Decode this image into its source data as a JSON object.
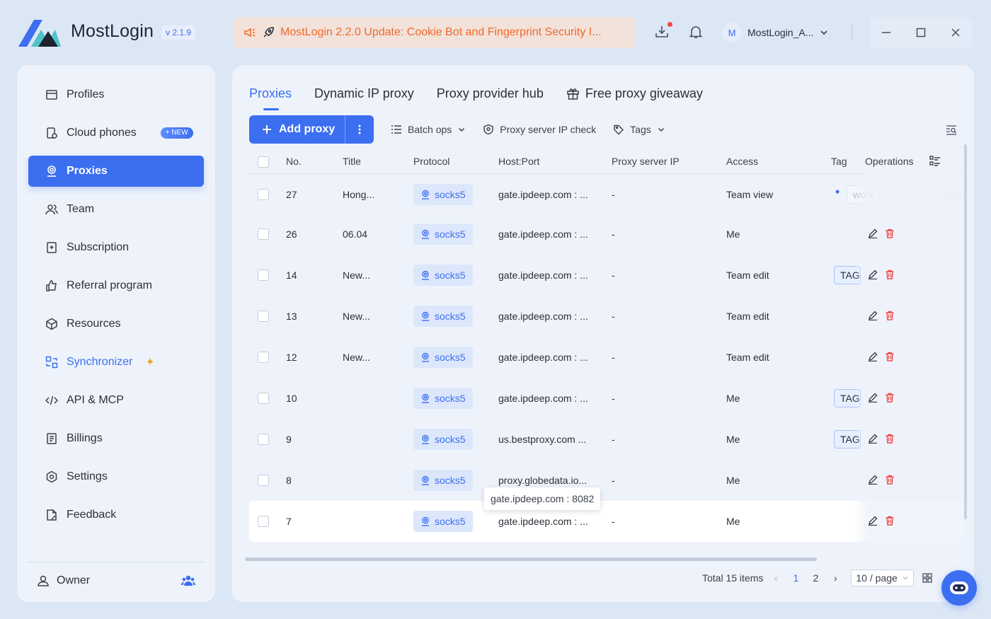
{
  "app": {
    "name": "MostLogin",
    "version": "v 2.1.9",
    "brand_color": "#3b6ff0"
  },
  "announcement": {
    "text": "MostLogin 2.2.0 Update: Cookie Bot and Fingerprint Security I..."
  },
  "user": {
    "avatar_letter": "M",
    "name": "MostLogin_A..."
  },
  "sidebar": {
    "items": [
      {
        "label": "Profiles",
        "icon": "profiles-icon"
      },
      {
        "label": "Cloud phones",
        "icon": "phone-icon",
        "badge": "+ NEW"
      },
      {
        "label": "Proxies",
        "icon": "proxy-icon",
        "active": true
      },
      {
        "label": "Team",
        "icon": "team-icon"
      },
      {
        "label": "Subscription",
        "icon": "subscription-icon"
      },
      {
        "label": "Referral program",
        "icon": "thumbs-up-icon"
      },
      {
        "label": "Resources",
        "icon": "cube-icon"
      },
      {
        "label": "Synchronizer",
        "icon": "synchronizer-icon"
      },
      {
        "label": "API & MCP",
        "icon": "code-icon"
      },
      {
        "label": "Billings",
        "icon": "billing-icon"
      },
      {
        "label": "Settings",
        "icon": "settings-icon"
      },
      {
        "label": "Feedback",
        "icon": "feedback-icon"
      }
    ],
    "owner_label": "Owner"
  },
  "tabs": [
    "Proxies",
    "Dynamic IP proxy",
    "Proxy provider hub",
    "Free proxy giveaway"
  ],
  "toolbar": {
    "add_proxy": "Add proxy",
    "batch_ops": "Batch ops",
    "ip_check": "Proxy server IP check",
    "tags": "Tags"
  },
  "table": {
    "columns": [
      "No.",
      "Title",
      "Protocol",
      "Host:Port",
      "Proxy server IP",
      "Access",
      "Tag",
      "Operations"
    ],
    "rows": [
      {
        "no": "27",
        "title": "Hong...",
        "protocol": "socks5",
        "host": "gate.ipdeep.com : ...",
        "ip": "-",
        "access": "Team view",
        "tag": "work",
        "extra": "Canv"
      },
      {
        "no": "26",
        "title": "06.04",
        "protocol": "socks5",
        "host": "gate.ipdeep.com : ...",
        "ip": "-",
        "access": "Me",
        "tag": ""
      },
      {
        "no": "14",
        "title": "New...",
        "protocol": "socks5",
        "host": "gate.ipdeep.com : ...",
        "ip": "-",
        "access": "Team edit",
        "tag": "TAG"
      },
      {
        "no": "13",
        "title": "New...",
        "protocol": "socks5",
        "host": "gate.ipdeep.com : ...",
        "ip": "-",
        "access": "Team edit",
        "tag": ""
      },
      {
        "no": "12",
        "title": "New...",
        "protocol": "socks5",
        "host": "gate.ipdeep.com : ...",
        "ip": "-",
        "access": "Team edit",
        "tag": ""
      },
      {
        "no": "10",
        "title": "",
        "protocol": "socks5",
        "host": "gate.ipdeep.com : ...",
        "ip": "-",
        "access": "Me",
        "tag": "TAG"
      },
      {
        "no": "9",
        "title": "",
        "protocol": "socks5",
        "host": "us.bestproxy.com ...",
        "ip": "-",
        "access": "Me",
        "tag": "TAG"
      },
      {
        "no": "8",
        "title": "",
        "protocol": "socks5",
        "host": "proxy.globedata.io...",
        "ip": "-",
        "access": "Me",
        "tag": ""
      },
      {
        "no": "7",
        "title": "",
        "protocol": "socks5",
        "host": "gate.ipdeep.com : ...",
        "ip": "-",
        "access": "Me",
        "tag": ""
      }
    ],
    "tooltip": "gate.ipdeep.com : 8082"
  },
  "pagination": {
    "total": "Total 15 items",
    "pages": [
      "1",
      "2"
    ],
    "current": "1",
    "page_size": "10 / page"
  }
}
